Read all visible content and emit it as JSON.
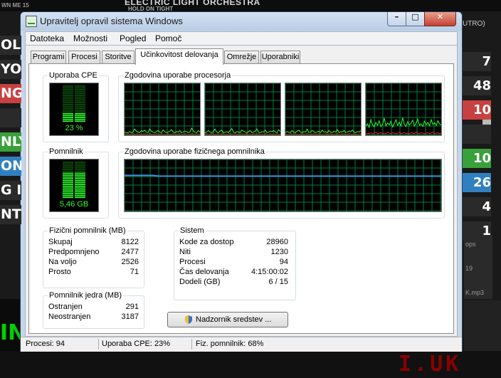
{
  "background": {
    "title": "ELECTRIC LIGHT ORCHESTRA",
    "subtitle": "HOLD ON TIGHT",
    "small_text": "WN ME 15",
    "right_top": "UTRO)",
    "left_rows": [
      {
        "text": "OLL",
        "color": "#2a2a2a"
      },
      {
        "text": "YO",
        "color": "#2a2a2a"
      },
      {
        "text": "NG",
        "color": "#c84040"
      },
      {
        "text": "",
        "color": "#2a2a2a"
      },
      {
        "text": "NLY",
        "color": "#3aa03a"
      },
      {
        "text": "ON",
        "color": "#3080c0"
      },
      {
        "text": "G I",
        "color": "#2a2a2a"
      },
      {
        "text": "NT",
        "color": "#2a2a2a"
      }
    ],
    "right_nums": [
      {
        "text": "7",
        "color": "#2a2a2a"
      },
      {
        "text": "48",
        "color": "#2a2a2a"
      },
      {
        "text": "10",
        "color": "#c84040"
      },
      {
        "text": "",
        "color": "#2a2a2a"
      },
      {
        "text": "10",
        "color": "#3aa03a"
      },
      {
        "text": "26",
        "color": "#3080c0"
      },
      {
        "text": "4",
        "color": "#2a2a2a"
      },
      {
        "text": "1",
        "color": "#2a2a2a"
      }
    ],
    "right_box_lines": [
      "ops",
      "19",
      "K.mp3"
    ],
    "green_text": "IN",
    "red_text": "I.UK"
  },
  "window": {
    "title": "Upravitelj opravil sistema Windows",
    "menu": [
      "Datoteka",
      "Možnosti",
      "Pogled",
      "Pomoč"
    ],
    "tabs": [
      "Programi",
      "Procesi",
      "Storitve",
      "Učinkovitost delovanja",
      "Omrežje",
      "Uporabniki"
    ],
    "active_tab": 3,
    "cpu_group_label": "Uporaba CPE",
    "cpu_usage_text": "23 %",
    "cpu_usage_fraction": 0.23,
    "cpu_history_label": "Zgodovina uporabe procesorja",
    "cpu_history": [
      [
        6,
        5,
        5,
        7,
        5,
        6,
        12,
        8,
        6,
        5,
        9,
        7,
        10,
        6,
        5,
        12,
        8,
        6,
        5,
        7,
        9,
        6,
        5,
        10,
        7,
        5,
        6,
        8,
        11,
        6,
        5,
        7,
        6,
        9,
        5,
        6,
        8,
        7,
        5,
        6,
        14,
        8,
        6,
        5,
        9,
        6
      ],
      [
        5,
        6,
        9,
        6,
        5,
        7,
        12,
        6,
        5,
        8,
        10,
        5,
        6,
        7,
        5,
        9,
        13,
        6,
        5,
        7,
        6,
        5,
        10,
        8,
        6,
        5,
        7,
        9,
        5,
        6,
        8,
        12,
        6,
        5,
        7,
        6,
        10,
        5,
        6,
        8,
        7,
        9,
        6,
        5,
        11,
        7
      ],
      [
        5,
        7,
        6,
        5,
        9,
        6,
        5,
        8,
        10,
        6,
        5,
        7,
        6,
        12,
        5,
        6,
        9,
        7,
        5,
        6,
        8,
        5,
        10,
        6,
        7,
        5,
        9,
        6,
        5,
        8,
        6,
        11,
        5,
        7,
        6,
        9,
        5,
        6,
        8,
        7,
        10,
        6,
        5,
        7,
        6,
        9
      ],
      [
        18,
        22,
        15,
        30,
        20,
        16,
        25,
        19,
        28,
        17,
        21,
        33,
        18,
        24,
        20,
        27,
        16,
        22,
        30,
        19,
        25,
        18,
        34,
        21,
        17,
        26,
        20,
        23,
        29,
        18,
        24,
        31,
        19,
        22,
        17,
        27,
        20,
        25,
        18,
        30,
        21,
        24,
        19,
        28,
        22,
        20
      ]
    ],
    "kernel_history": [
      [
        2,
        2,
        3,
        2,
        2,
        3,
        2,
        2,
        3,
        2,
        2,
        2,
        3,
        2,
        2,
        3,
        2,
        2,
        2,
        3,
        2,
        2,
        3,
        2,
        2,
        2,
        3,
        2,
        2,
        3,
        2,
        2,
        2,
        3,
        2,
        2,
        3,
        2,
        2,
        2,
        3,
        2,
        2,
        3,
        2,
        2
      ],
      [
        2,
        3,
        2,
        2,
        3,
        2,
        2,
        2,
        3,
        2,
        2,
        3,
        2,
        2,
        2,
        3,
        2,
        2,
        3,
        2,
        2,
        2,
        3,
        2,
        2,
        3,
        2,
        2,
        2,
        3,
        2,
        2,
        3,
        2,
        2,
        2,
        3,
        2,
        2,
        3,
        2,
        2,
        2,
        3,
        2,
        2
      ],
      [
        2,
        2,
        2,
        3,
        2,
        2,
        3,
        2,
        2,
        2,
        3,
        2,
        2,
        3,
        2,
        2,
        2,
        3,
        2,
        2,
        3,
        2,
        2,
        2,
        3,
        2,
        2,
        3,
        2,
        2,
        2,
        3,
        2,
        2,
        3,
        2,
        2,
        2,
        3,
        2,
        2,
        3,
        2,
        2,
        2,
        3
      ],
      [
        3,
        4,
        3,
        5,
        3,
        4,
        6,
        3,
        4,
        5,
        3,
        4,
        3,
        6,
        4,
        3,
        5,
        4,
        3,
        4,
        6,
        3,
        4,
        5,
        3,
        4,
        3,
        5,
        4,
        3,
        6,
        4,
        3,
        5,
        4,
        3,
        4,
        5,
        3,
        4,
        6,
        3,
        4,
        5,
        3,
        4
      ]
    ],
    "mem_group_label": "Pomnilnik",
    "mem_usage_text": "5,46 GB",
    "mem_usage_fraction": 0.68,
    "mem_history_label": "Zgodovina uporabe fizičnega pomnilnika",
    "mem_history_fraction": 0.68,
    "physical": {
      "label": "Fizični pomnilnik (MB)",
      "rows": [
        {
          "k": "Skupaj",
          "v": "8122"
        },
        {
          "k": "Predpomnjeno",
          "v": "2477"
        },
        {
          "k": "Na voljo",
          "v": "2526"
        },
        {
          "k": "Prosto",
          "v": "71"
        }
      ]
    },
    "kernel": {
      "label": "Pomnilnik jedra (MB)",
      "rows": [
        {
          "k": "Ostranjen",
          "v": "291"
        },
        {
          "k": "Neostranjen",
          "v": "3187"
        }
      ]
    },
    "system": {
      "label": "Sistem",
      "rows": [
        {
          "k": "Kode za dostop",
          "v": "28960"
        },
        {
          "k": "Niti",
          "v": "1230"
        },
        {
          "k": "Procesi",
          "v": "94"
        },
        {
          "k": "Čas delovanja",
          "v": "4:15:00:02"
        },
        {
          "k": "Dodeli (GB)",
          "v": "6 / 15"
        }
      ]
    },
    "resource_monitor_button": "Nadzornik sredstev ...",
    "status": {
      "processes": "Procesi: 94",
      "cpu": "Uporaba CPE: 23%",
      "memory": "Fiz. pomnilnik: 68%"
    },
    "colors": {
      "graph_green": "#2cff2c",
      "graph_red": "#e02020",
      "grid": "#008040",
      "mem_line": "#3a8fe0"
    }
  }
}
